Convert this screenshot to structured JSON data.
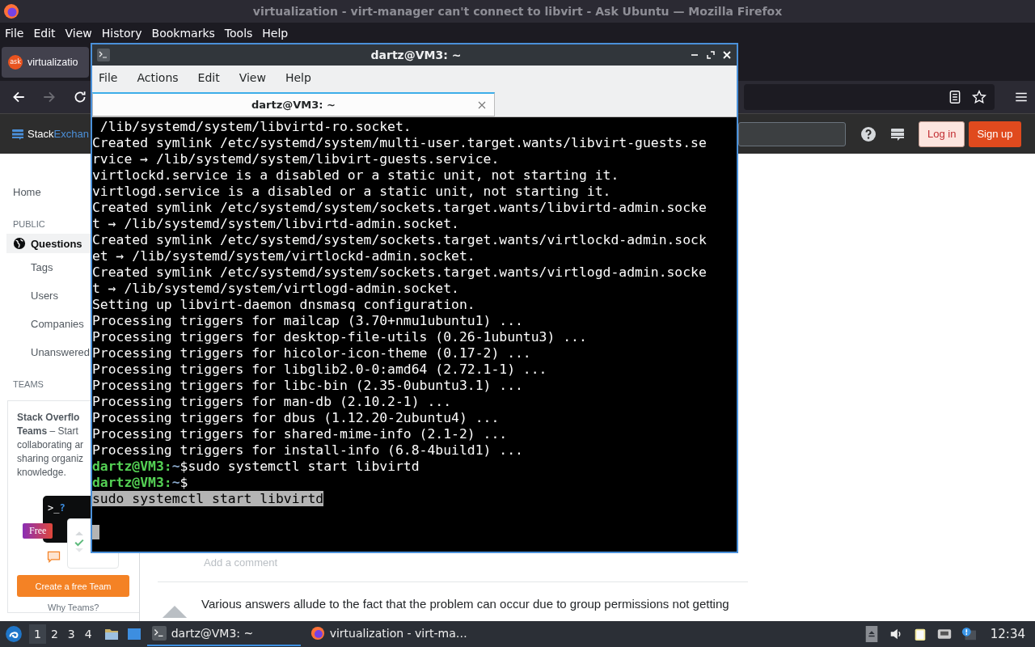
{
  "browser": {
    "title": "virtualization - virt-manager can't connect to libvirt - Ask Ubuntu — Mozilla Firefox",
    "menu": [
      "File",
      "Edit",
      "View",
      "History",
      "Bookmarks",
      "Tools",
      "Help"
    ],
    "tab": {
      "label": "virtualizatio",
      "favicon": "ask"
    },
    "nav": {
      "forward_disabled": true
    }
  },
  "site": {
    "logo": {
      "part_1": "Stack",
      "part_2": "Exchan"
    },
    "login": "Log in",
    "signup": "Sign up",
    "sidebar": {
      "items": [
        {
          "kind": "link",
          "label": "Home",
          "selected": false
        },
        {
          "kind": "heading",
          "label": "PUBLIC"
        },
        {
          "kind": "icon_link",
          "label": "Questions",
          "selected": true
        },
        {
          "kind": "sub",
          "label": "Tags",
          "selected": false
        },
        {
          "kind": "sub",
          "label": "Users",
          "selected": false
        },
        {
          "kind": "sub",
          "label": "Companies",
          "selected": false
        },
        {
          "kind": "sub",
          "label": "Unanswered",
          "selected": false
        },
        {
          "kind": "heading",
          "label": "TEAMS"
        }
      ],
      "teams": {
        "lines": [
          "**Stack Overflo**",
          "**Teams** – Start",
          "collaborating ar",
          "sharing organiz",
          "knowledge."
        ],
        "prompt": ">_",
        "question": "?",
        "badge": "Free",
        "button": "Create a free Team",
        "link": "Why Teams?"
      }
    },
    "comment_link": "Add a comment",
    "answer_text": "Various answers allude to the fact that the problem can occur due to group permissions not getting"
  },
  "terminal": {
    "title": "dartz@VM3: ~",
    "menu": [
      "File",
      "Actions",
      "Edit",
      "View",
      "Help"
    ],
    "tab": "dartz@VM3: ~",
    "lines": [
      {
        "kind": "output",
        "text": " /lib/systemd/system/libvirtd-ro.socket."
      },
      {
        "kind": "output",
        "text": "Created symlink /etc/systemd/system/multi-user.target.wants/libvirt-guests.se"
      },
      {
        "kind": "output",
        "text": "rvice → /lib/systemd/system/libvirt-guests.service."
      },
      {
        "kind": "output",
        "text": "virtlockd.service is a disabled or a static unit, not starting it."
      },
      {
        "kind": "output",
        "text": "virtlogd.service is a disabled or a static unit, not starting it."
      },
      {
        "kind": "output",
        "text": "Created symlink /etc/systemd/system/sockets.target.wants/libvirtd-admin.socke"
      },
      {
        "kind": "output",
        "text": "t → /lib/systemd/system/libvirtd-admin.socket."
      },
      {
        "kind": "output",
        "text": "Created symlink /etc/systemd/system/sockets.target.wants/virtlockd-admin.sock"
      },
      {
        "kind": "output",
        "text": "et → /lib/systemd/system/virtlockd-admin.socket."
      },
      {
        "kind": "output",
        "text": "Created symlink /etc/systemd/system/sockets.target.wants/virtlogd-admin.socke"
      },
      {
        "kind": "output",
        "text": "t → /lib/systemd/system/virtlogd-admin.socket."
      },
      {
        "kind": "output",
        "text": "Setting up libvirt-daemon dnsmasq configuration."
      },
      {
        "kind": "output",
        "text": "Processing triggers for mailcap (3.70+nmu1ubuntu1) ..."
      },
      {
        "kind": "output",
        "text": "Processing triggers for desktop-file-utils (0.26-1ubuntu3) ..."
      },
      {
        "kind": "output",
        "text": "Processing triggers for hicolor-icon-theme (0.17-2) ..."
      },
      {
        "kind": "output",
        "text": "Processing triggers for libglib2.0-0:amd64 (2.72.1-1) ..."
      },
      {
        "kind": "output",
        "text": "Processing triggers for libc-bin (2.35-0ubuntu3.1) ..."
      },
      {
        "kind": "output",
        "text": "Processing triggers for man-db (2.10.2-1) ..."
      },
      {
        "kind": "output",
        "text": "Processing triggers for dbus (1.12.20-2ubuntu4) ..."
      },
      {
        "kind": "output",
        "text": "Processing triggers for shared-mime-info (2.1-2) ..."
      },
      {
        "kind": "output",
        "text": "Processing triggers for install-info (6.8-4build1) ..."
      },
      {
        "kind": "prompt",
        "user": "dartz@VM3:",
        "path": "~",
        "sign": "$",
        "command": "sudo systemctl start libvirtd"
      },
      {
        "kind": "prompt",
        "user": "dartz@VM3:",
        "path": "~",
        "sign": "$"
      },
      {
        "kind": "selected",
        "text": "sudo systemctl start libvirtd"
      },
      {
        "kind": "blank"
      },
      {
        "kind": "cursor"
      }
    ]
  },
  "taskbar": {
    "workspaces": [
      {
        "label": "1",
        "selected": true
      },
      {
        "label": "2",
        "selected": false
      },
      {
        "label": "3",
        "selected": false
      },
      {
        "label": "4",
        "selected": false
      }
    ],
    "tasks": [
      {
        "kind": "terminal",
        "label": "dartz@VM3: ~",
        "selected": true
      },
      {
        "kind": "browser",
        "label": "virtualization - virt-ma…",
        "selected": false
      }
    ],
    "clock": "12:34"
  }
}
